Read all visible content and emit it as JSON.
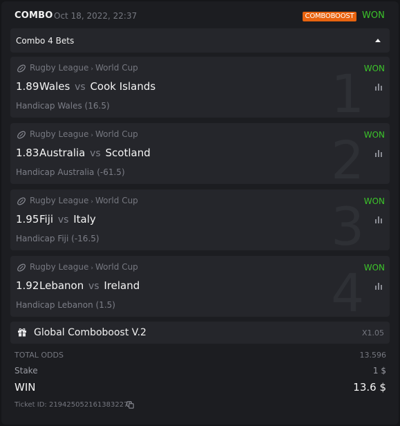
{
  "header": {
    "type_label": "COMBO",
    "date": "Oct 18, 2022, 22:37",
    "boost_badge": "COMBOBOOST",
    "status": "WON"
  },
  "combo": {
    "label": "Combo 4 Bets",
    "expand_icon": "caret-up-icon"
  },
  "bets": [
    {
      "sport": "Rugby League",
      "league": "World Cup",
      "result": "WON",
      "odds": "1.89",
      "home": "Wales",
      "vs": "vs",
      "away": "Cook Islands",
      "market": "Handicap Wales (16.5)",
      "index": "1"
    },
    {
      "sport": "Rugby League",
      "league": "World Cup",
      "result": "WON",
      "odds": "1.83",
      "home": "Australia",
      "vs": "vs",
      "away": "Scotland",
      "market": "Handicap Australia (-61.5)",
      "index": "2"
    },
    {
      "sport": "Rugby League",
      "league": "World Cup",
      "result": "WON",
      "odds": "1.95",
      "home": "Fiji",
      "vs": "vs",
      "away": "Italy",
      "market": "Handicap Fiji (-16.5)",
      "index": "3"
    },
    {
      "sport": "Rugby League",
      "league": "World Cup",
      "result": "WON",
      "odds": "1.92",
      "home": "Lebanon",
      "vs": "vs",
      "away": "Ireland",
      "market": "Handicap Lebanon (1.5)",
      "index": "4"
    }
  ],
  "boost": {
    "label": "Global Comboboost V.2",
    "multiplier": "X1.05",
    "icon": "gift-icon"
  },
  "summary": {
    "total_odds_label": "TOTAL ODDS",
    "total_odds_value": "13.596",
    "stake_label": "Stake",
    "stake_value": "1 $",
    "win_label": "WIN",
    "win_value": "13.6 $"
  },
  "ticket": {
    "text": "Ticket ID: 2194250521613832275"
  },
  "colors": {
    "won": "#3cc52a",
    "boost_badge": "#e8630f",
    "panel": "#25262b",
    "background": "#1c1d21"
  }
}
